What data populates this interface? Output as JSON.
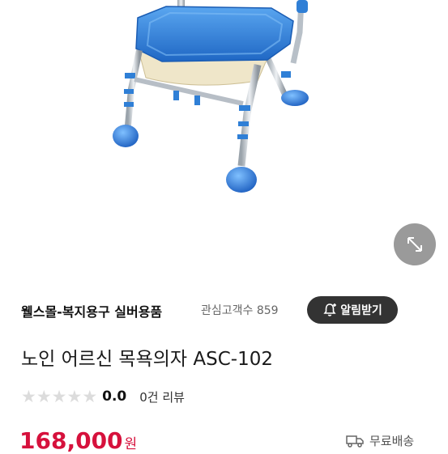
{
  "store": {
    "name": "웰스몰-복지용구 실버용품",
    "interest_label": "관심고객수",
    "interest_count": "859",
    "alarm_label": "알림받기"
  },
  "product": {
    "title": "노인 어르신 목욕의자 ASC-102",
    "rating_value": "0.0",
    "review_label": "0건 리뷰",
    "rating_stars": 0,
    "price": "168,000",
    "price_unit": "원",
    "shipping_label": "무료배송"
  },
  "icons": {
    "expand": "expand-arrows-icon",
    "bell": "bell-plus-icon",
    "truck": "delivery-truck-icon",
    "star": "star-icon"
  },
  "colors": {
    "price": "#d6113c",
    "alarm_button_bg": "#333333",
    "expand_button_bg": "#9a9a9a",
    "chair_blue": "#2f7fd6",
    "star_empty": "#dcdcdc"
  }
}
